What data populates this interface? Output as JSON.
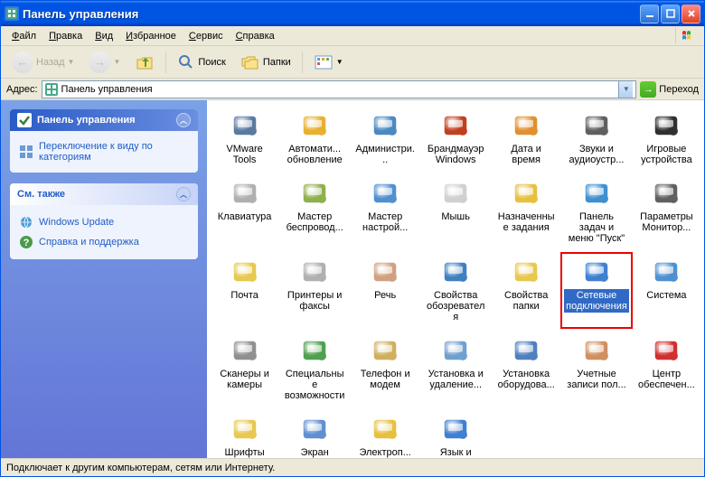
{
  "title": "Панель управления",
  "menu": [
    "Файл",
    "Правка",
    "Вид",
    "Избранное",
    "Сервис",
    "Справка"
  ],
  "toolbar": {
    "back": "Назад",
    "search": "Поиск",
    "folders": "Папки"
  },
  "address": {
    "label": "Адрес:",
    "value": "Панель управления",
    "go": "Переход"
  },
  "sidebar": {
    "main": {
      "title": "Панель управления",
      "switch": "Переключение к виду по категориям"
    },
    "see": {
      "title": "См. также",
      "links": [
        "Windows Update",
        "Справка и поддержка"
      ]
    }
  },
  "items": [
    {
      "l": "VMware Tools",
      "c": "#5a7aa0"
    },
    {
      "l": "Автомати... обновление",
      "c": "#e8b030"
    },
    {
      "l": "Администри...",
      "c": "#4a8ac0"
    },
    {
      "l": "Брандмауэр Windows",
      "c": "#c04020"
    },
    {
      "l": "Дата и время",
      "c": "#e09030"
    },
    {
      "l": "Звуки и аудиоустр...",
      "c": "#606060"
    },
    {
      "l": "Игровые устройства",
      "c": "#303030"
    },
    {
      "l": "Клавиатура",
      "c": "#b0b0b0"
    },
    {
      "l": "Мастер беспровод...",
      "c": "#90b050"
    },
    {
      "l": "Мастер настрой...",
      "c": "#5090d0"
    },
    {
      "l": "Мышь",
      "c": "#d0d0d0"
    },
    {
      "l": "Назначенные задания",
      "c": "#e8c040"
    },
    {
      "l": "Панель задач и меню \"Пуск\"",
      "c": "#4090d0"
    },
    {
      "l": "Параметры Монитор...",
      "c": "#606060"
    },
    {
      "l": "Почта",
      "c": "#e8c850"
    },
    {
      "l": "Принтеры и факсы",
      "c": "#b0b0b0"
    },
    {
      "l": "Речь",
      "c": "#d0a080"
    },
    {
      "l": "Свойства обозревателя",
      "c": "#4080c0"
    },
    {
      "l": "Свойства папки",
      "c": "#e8c850"
    },
    {
      "l": "Сетевые подключения",
      "c": "#4080d0",
      "sel": true,
      "hl": true
    },
    {
      "l": "Система",
      "c": "#5090d0"
    },
    {
      "l": "Сканеры и камеры",
      "c": "#909090"
    },
    {
      "l": "Специальные возможности",
      "c": "#50a050"
    },
    {
      "l": "Телефон и модем",
      "c": "#d0b060"
    },
    {
      "l": "Установка и удаление...",
      "c": "#70a0d0"
    },
    {
      "l": "Установка оборудова...",
      "c": "#5080c0"
    },
    {
      "l": "Учетные записи пол...",
      "c": "#d09060"
    },
    {
      "l": "Центр обеспечен...",
      "c": "#d03030"
    },
    {
      "l": "Шрифты",
      "c": "#e8c850"
    },
    {
      "l": "Экран",
      "c": "#6090d0"
    },
    {
      "l": "Электроп...",
      "c": "#e8c040"
    },
    {
      "l": "Язык и региональ...",
      "c": "#4080d0"
    }
  ],
  "status": "Подключает к другим компьютерам, сетям или Интернету."
}
